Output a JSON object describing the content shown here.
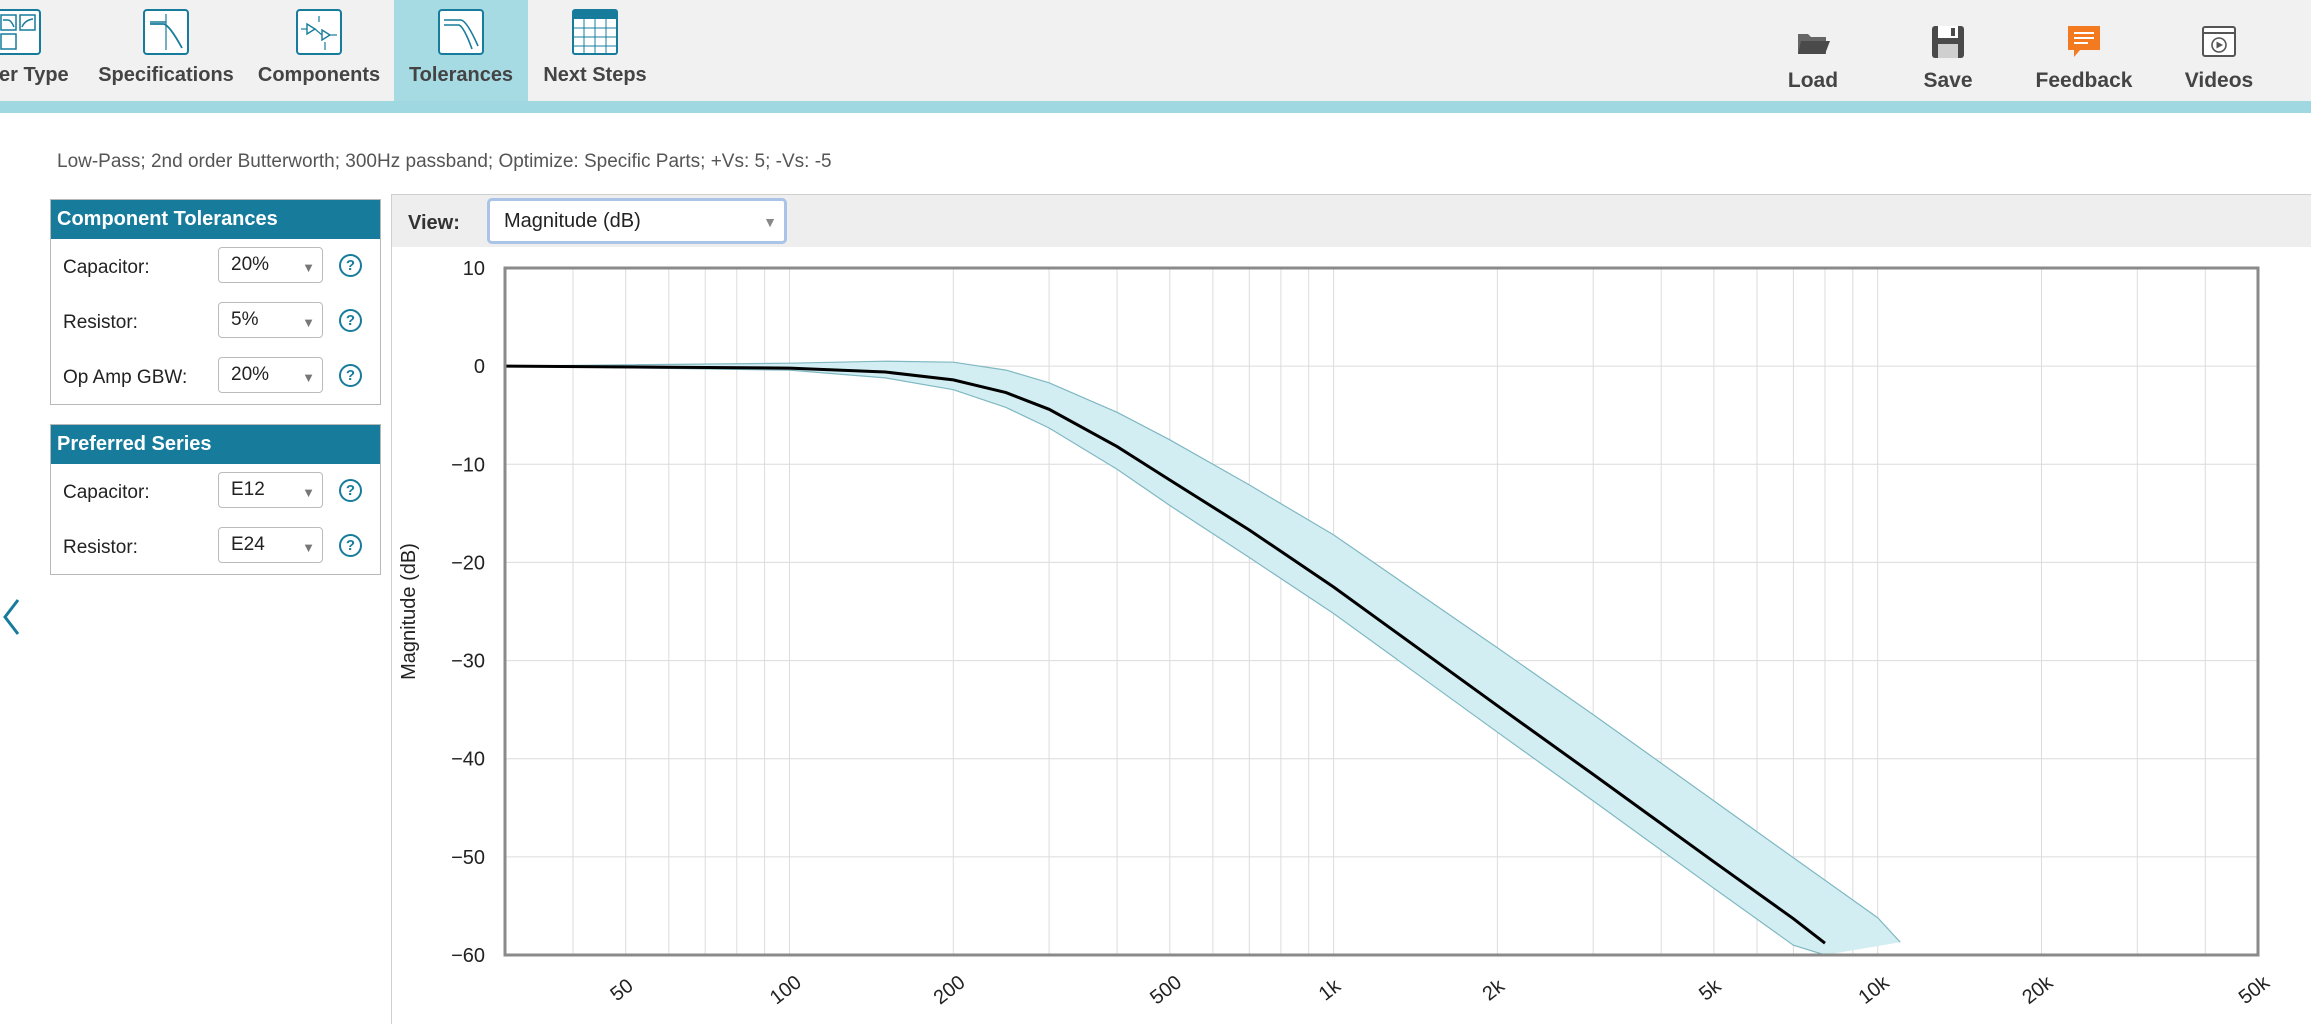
{
  "toolbar": {
    "tabs": [
      {
        "label": "er Type",
        "icon": "filter-type-icon"
      },
      {
        "label": "Specifications",
        "icon": "specifications-icon"
      },
      {
        "label": "Components",
        "icon": "components-icon"
      },
      {
        "label": "Tolerances",
        "icon": "tolerances-icon",
        "active": true
      },
      {
        "label": "Next Steps",
        "icon": "next-steps-icon"
      }
    ],
    "actions": {
      "load": "Load",
      "save": "Save",
      "feedback": "Feedback",
      "videos": "Videos"
    }
  },
  "summary": "Low-Pass; 2nd order Butterworth; 300Hz passband; Optimize: Specific Parts; +Vs: 5; -Vs: -5",
  "component_tolerances": {
    "title": "Component Tolerances",
    "rows": [
      {
        "label": "Capacitor:",
        "value": "20%"
      },
      {
        "label": "Resistor:",
        "value": "5%"
      },
      {
        "label": "Op Amp GBW:",
        "value": "20%"
      }
    ]
  },
  "preferred_series": {
    "title": "Preferred Series",
    "rows": [
      {
        "label": "Capacitor:",
        "value": "E12"
      },
      {
        "label": "Resistor:",
        "value": "E24"
      }
    ]
  },
  "help_glyph": "?",
  "view": {
    "label": "View:",
    "selected": "Magnitude (dB)"
  },
  "colors": {
    "accent": "#177c9c",
    "toolbar_stripe": "#9fd8e1",
    "band_fill": "#d3eef3",
    "band_stroke": "#7fb8c2",
    "feedback_icon": "#f47a20"
  },
  "chart_data": {
    "type": "line",
    "ylabel": "Magnitude (dB)",
    "xscale": "log",
    "xlim": [
      30,
      50000
    ],
    "ylim": [
      -60,
      10
    ],
    "x_ticks": [
      {
        "value": 50,
        "label": "50"
      },
      {
        "value": 100,
        "label": "100"
      },
      {
        "value": 200,
        "label": "200"
      },
      {
        "value": 500,
        "label": "500"
      },
      {
        "value": 1000,
        "label": "1k"
      },
      {
        "value": 2000,
        "label": "2k"
      },
      {
        "value": 5000,
        "label": "5k"
      },
      {
        "value": 10000,
        "label": "10k"
      },
      {
        "value": 20000,
        "label": "20k"
      },
      {
        "value": 50000,
        "label": "50k"
      }
    ],
    "y_ticks": [
      {
        "value": 10,
        "label": "10"
      },
      {
        "value": 0,
        "label": "0"
      },
      {
        "value": -10,
        "label": "−10"
      },
      {
        "value": -20,
        "label": "−20"
      },
      {
        "value": -30,
        "label": "−30"
      },
      {
        "value": -40,
        "label": "−40"
      },
      {
        "value": -50,
        "label": "−50"
      },
      {
        "value": -60,
        "label": "−60"
      }
    ],
    "grid": true,
    "nominal": {
      "x": [
        30,
        100,
        150,
        200,
        250,
        300,
        400,
        500,
        700,
        1000,
        2000,
        3000,
        5000,
        7000,
        8000
      ],
      "y": [
        0,
        -0.2,
        -0.6,
        -1.4,
        -2.7,
        -4.4,
        -8.2,
        -11.6,
        -16.7,
        -22.5,
        -34.6,
        -41.6,
        -50.5,
        -56.3,
        -58.8
      ]
    },
    "band_upper": {
      "x": [
        30,
        100,
        150,
        200,
        250,
        300,
        400,
        500,
        700,
        1000,
        2000,
        3000,
        5000,
        7000,
        10000,
        11000
      ],
      "y": [
        0,
        0.3,
        0.5,
        0.4,
        -0.4,
        -1.7,
        -4.7,
        -7.5,
        -12.1,
        -17.2,
        -28.7,
        -35.5,
        -44.3,
        -50.1,
        -56.2,
        -58.7
      ]
    },
    "band_lower": {
      "x": [
        30,
        100,
        150,
        200,
        250,
        300,
        400,
        500,
        700,
        1000,
        2000,
        3000,
        5000,
        7000,
        8000
      ],
      "y": [
        0,
        -0.4,
        -1.2,
        -2.4,
        -4.2,
        -6.3,
        -10.5,
        -14.2,
        -19.5,
        -25.2,
        -37.3,
        -44.3,
        -53.2,
        -59.0,
        -60
      ]
    }
  }
}
